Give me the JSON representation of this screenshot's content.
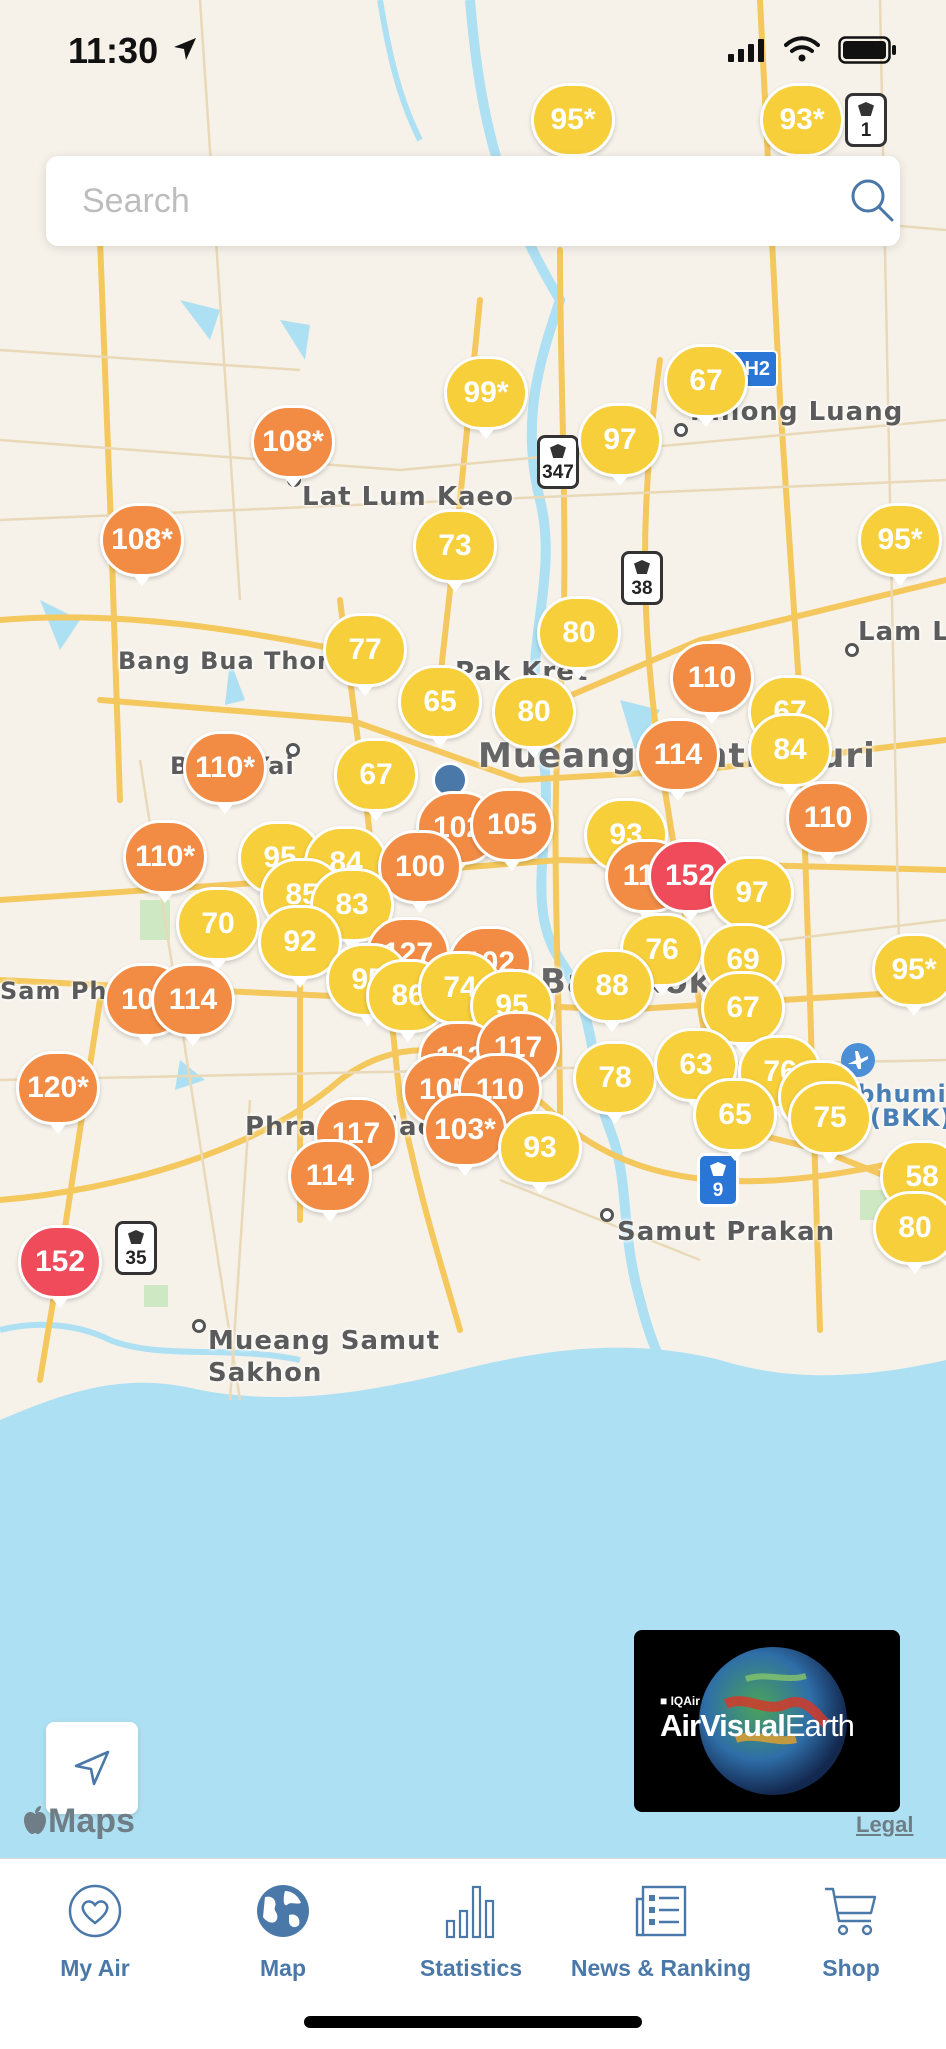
{
  "status_bar": {
    "time": "11:30"
  },
  "search": {
    "placeholder": "Search"
  },
  "map": {
    "places": [
      {
        "name": "Khlong Luang"
      },
      {
        "name": "Lat Lum Kaeo"
      },
      {
        "name": "Bang Bua Thong"
      },
      {
        "name": "Pak Kret"
      },
      {
        "name": "Mueang Nonthaburi"
      },
      {
        "name": "Lam L"
      },
      {
        "name": "Bang Yai"
      },
      {
        "name": "Sam Phran"
      },
      {
        "name": "Phra Pradaeng"
      },
      {
        "name": "Samut Prakan"
      },
      {
        "name": "Mueang Samut"
      },
      {
        "name": "Sakhon"
      },
      {
        "name": "Bangkok"
      },
      {
        "name": "abhumi"
      },
      {
        "name": "(BKK)"
      },
      {
        "name": "Nonthaburi"
      }
    ],
    "aqi_markers": [
      {
        "value": "95*",
        "level": "moderate"
      },
      {
        "value": "93*",
        "level": "moderate"
      },
      {
        "value": "99*",
        "level": "moderate"
      },
      {
        "value": "67",
        "level": "moderate"
      },
      {
        "value": "97",
        "level": "moderate"
      },
      {
        "value": "108*",
        "level": "unhealthy-sensitive"
      },
      {
        "value": "108*",
        "level": "unhealthy-sensitive"
      },
      {
        "value": "73",
        "level": "moderate"
      },
      {
        "value": "95*",
        "level": "moderate"
      },
      {
        "value": "80",
        "level": "moderate"
      },
      {
        "value": "77",
        "level": "moderate"
      },
      {
        "value": "65",
        "level": "moderate"
      },
      {
        "value": "80",
        "level": "moderate"
      },
      {
        "value": "110",
        "level": "unhealthy-sensitive"
      },
      {
        "value": "67",
        "level": "moderate"
      },
      {
        "value": "84",
        "level": "moderate"
      },
      {
        "value": "110*",
        "level": "unhealthy-sensitive"
      },
      {
        "value": "67",
        "level": "moderate"
      },
      {
        "value": "114",
        "level": "unhealthy-sensitive"
      },
      {
        "value": "102",
        "level": "unhealthy-sensitive"
      },
      {
        "value": "105",
        "level": "unhealthy-sensitive"
      },
      {
        "value": "93",
        "level": "moderate"
      },
      {
        "value": "110",
        "level": "unhealthy-sensitive"
      },
      {
        "value": "110*",
        "level": "unhealthy-sensitive"
      },
      {
        "value": "95",
        "level": "moderate"
      },
      {
        "value": "84",
        "level": "moderate"
      },
      {
        "value": "100",
        "level": "unhealthy-sensitive"
      },
      {
        "value": "114",
        "level": "unhealthy-sensitive"
      },
      {
        "value": "152",
        "level": "unhealthy"
      },
      {
        "value": "85",
        "level": "moderate"
      },
      {
        "value": "83",
        "level": "moderate"
      },
      {
        "value": "97",
        "level": "moderate"
      },
      {
        "value": "70",
        "level": "moderate"
      },
      {
        "value": "92",
        "level": "moderate"
      },
      {
        "value": "127",
        "level": "unhealthy-sensitive"
      },
      {
        "value": "102",
        "level": "unhealthy-sensitive"
      },
      {
        "value": "76",
        "level": "moderate"
      },
      {
        "value": "69",
        "level": "moderate"
      },
      {
        "value": "95*",
        "level": "moderate"
      },
      {
        "value": "107",
        "level": "unhealthy-sensitive"
      },
      {
        "value": "114",
        "level": "unhealthy-sensitive"
      },
      {
        "value": "95",
        "level": "moderate"
      },
      {
        "value": "86",
        "level": "moderate"
      },
      {
        "value": "74",
        "level": "moderate"
      },
      {
        "value": "95",
        "level": "moderate"
      },
      {
        "value": "88",
        "level": "moderate"
      },
      {
        "value": "67",
        "level": "moderate"
      },
      {
        "value": "120*",
        "level": "unhealthy-sensitive"
      },
      {
        "value": "112",
        "level": "unhealthy-sensitive"
      },
      {
        "value": "117",
        "level": "unhealthy-sensitive"
      },
      {
        "value": "105",
        "level": "unhealthy-sensitive"
      },
      {
        "value": "110",
        "level": "unhealthy-sensitive"
      },
      {
        "value": "78",
        "level": "moderate"
      },
      {
        "value": "63",
        "level": "moderate"
      },
      {
        "value": "76",
        "level": "moderate"
      },
      {
        "value": "69",
        "level": "moderate"
      },
      {
        "value": "65",
        "level": "moderate"
      },
      {
        "value": "75",
        "level": "moderate"
      },
      {
        "value": "117",
        "level": "unhealthy-sensitive"
      },
      {
        "value": "103*",
        "level": "unhealthy-sensitive"
      },
      {
        "value": "93",
        "level": "moderate"
      },
      {
        "value": "114",
        "level": "unhealthy-sensitive"
      },
      {
        "value": "58",
        "level": "moderate"
      },
      {
        "value": "80",
        "level": "moderate"
      },
      {
        "value": "152",
        "level": "unhealthy"
      }
    ],
    "route_shields": [
      "1",
      "347",
      "38",
      "35",
      "9"
    ],
    "highway_badges": [
      "AH2"
    ],
    "attribution": "Maps",
    "legal_label": "Legal"
  },
  "promo": {
    "brand": "IQAir",
    "title_a": "AirVisual",
    "title_b": "Earth"
  },
  "tabs": [
    {
      "label": "My Air",
      "icon": "heart-icon"
    },
    {
      "label": "Map",
      "icon": "globe-icon"
    },
    {
      "label": "Statistics",
      "icon": "bar-chart-icon"
    },
    {
      "label": "News & Ranking",
      "icon": "news-icon"
    },
    {
      "label": "Shop",
      "icon": "cart-icon"
    }
  ],
  "colors": {
    "moderate": "#f6cf3b",
    "unhealthy-sensitive": "#f28c45",
    "unhealthy": "#ef4b5b",
    "tab_active": "#4a78a8",
    "water": "#aee0f3"
  }
}
